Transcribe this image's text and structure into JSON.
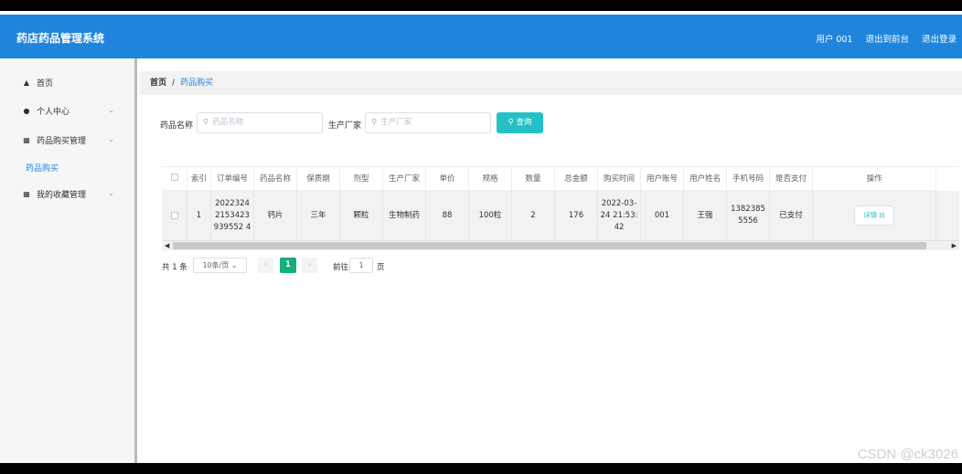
{
  "app": {
    "title": "药店药品管理系统"
  },
  "topbar": {
    "user": "用户 001",
    "front": "退出到前台",
    "logout": "退出登录"
  },
  "sidebar": {
    "items": [
      {
        "label": "首页",
        "icon": "home-icon"
      },
      {
        "label": "个人中心",
        "icon": "user-icon"
      },
      {
        "label": "药品购买管理",
        "icon": "grid-icon"
      },
      {
        "label": "药品购买"
      },
      {
        "label": "我的收藏管理",
        "icon": "grid-icon"
      }
    ]
  },
  "breadcrumb": {
    "home": "首页",
    "sep": "/",
    "current": "药品购买"
  },
  "search": {
    "name_label": "药品名称",
    "name_placeholder": "药品名称",
    "maker_label": "生产厂家",
    "maker_placeholder": "生产厂家",
    "button": "查询"
  },
  "table": {
    "headers": [
      "",
      "索引",
      "订单编号",
      "药品名称",
      "保质期",
      "剂型",
      "生产厂家",
      "单价",
      "规格",
      "数量",
      "总金额",
      "购买时间",
      "用户账号",
      "用户姓名",
      "手机号码",
      "是否支付",
      "操作"
    ],
    "rows": [
      {
        "index": "1",
        "order": "20223242153423939552 4",
        "name": "钙片",
        "shelf": "三年",
        "form": "颗粒",
        "maker": "生物制药",
        "price": "88",
        "spec": "100粒",
        "qty": "2",
        "total": "176",
        "time": "2022-03-24 21:53:42",
        "account": "001",
        "username": "王强",
        "phone": "13823855556",
        "paid": "已支付",
        "action": "详情 ⊟"
      }
    ]
  },
  "pager": {
    "total": "共 1 条",
    "size": "10条/页",
    "page": "1",
    "goto": "前往",
    "goto_value": "1",
    "unit": "页"
  },
  "watermark": "CSDN @ck3026"
}
